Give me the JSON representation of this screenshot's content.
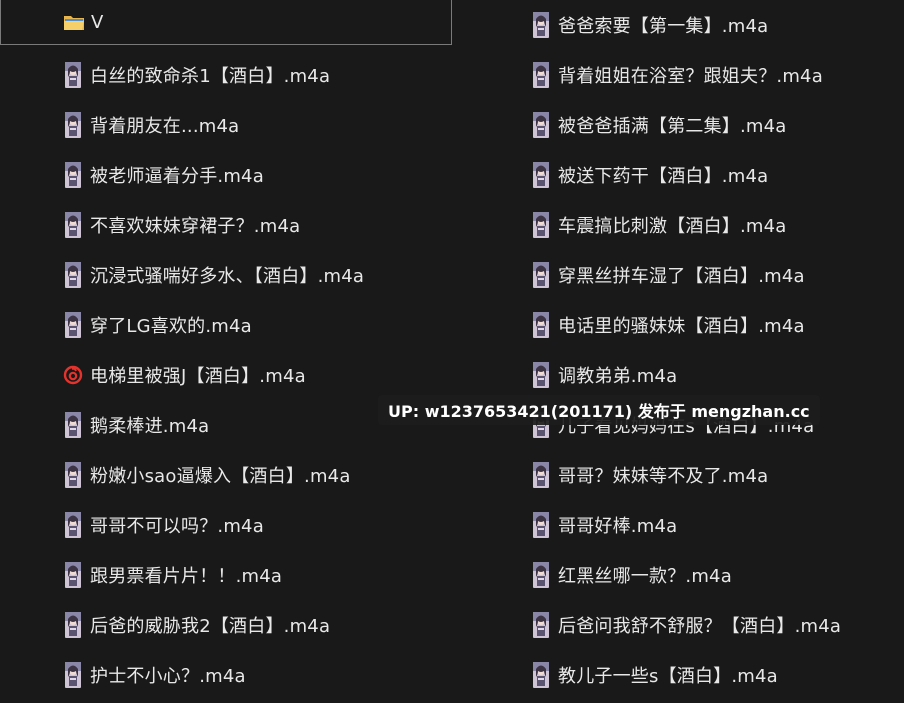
{
  "colors": {
    "background": "#191919",
    "text": "#e8e8e8",
    "selection_border": "#7a7a7a",
    "netease_icon": "#e4332c"
  },
  "folder": {
    "icon": "folder-icon",
    "label": "V"
  },
  "left_files": [
    {
      "icon": "audio-thumbnail-icon",
      "label": "白丝的致命杀1【酒白】.m4a"
    },
    {
      "icon": "audio-thumbnail-icon",
      "label": "背着朋友在...m4a"
    },
    {
      "icon": "audio-thumbnail-icon",
      "label": "被老师逼着分手.m4a"
    },
    {
      "icon": "audio-thumbnail-icon",
      "label": "不喜欢妹妹穿裙子？.m4a"
    },
    {
      "icon": "audio-thumbnail-icon",
      "label": "沉浸式骚喘好多水、【酒白】.m4a"
    },
    {
      "icon": "audio-thumbnail-icon",
      "label": "穿了LG喜欢的.m4a"
    },
    {
      "icon": "netease-music-icon",
      "label": "电梯里被强J【酒白】.m4a"
    },
    {
      "icon": "audio-thumbnail-icon",
      "label": "鹅柔棒进.m4a"
    },
    {
      "icon": "audio-thumbnail-icon",
      "label": "粉嫩小sao逼爆入【酒白】.m4a"
    },
    {
      "icon": "audio-thumbnail-icon",
      "label": "哥哥不可以吗？.m4a"
    },
    {
      "icon": "audio-thumbnail-icon",
      "label": "跟男票看片片！！.m4a"
    },
    {
      "icon": "audio-thumbnail-icon",
      "label": "后爸的威胁我2【酒白】.m4a"
    },
    {
      "icon": "audio-thumbnail-icon",
      "label": "护士不小心？.m4a"
    }
  ],
  "right_files": [
    {
      "icon": "audio-thumbnail-icon",
      "label": "爸爸索要【第一集】.m4a"
    },
    {
      "icon": "audio-thumbnail-icon",
      "label": "背着姐姐在浴室？跟姐夫？.m4a"
    },
    {
      "icon": "audio-thumbnail-icon",
      "label": "被爸爸插满【第二集】.m4a"
    },
    {
      "icon": "audio-thumbnail-icon",
      "label": "被送下药干【酒白】.m4a"
    },
    {
      "icon": "audio-thumbnail-icon",
      "label": "车震搞比刺激【酒白】.m4a"
    },
    {
      "icon": "audio-thumbnail-icon",
      "label": "穿黑丝拼车湿了【酒白】.m4a"
    },
    {
      "icon": "audio-thumbnail-icon",
      "label": "电话里的骚妹妹【酒白】.m4a"
    },
    {
      "icon": "audio-thumbnail-icon",
      "label": "调教弟弟.m4a"
    },
    {
      "icon": "audio-thumbnail-icon",
      "label": "儿子看见妈妈在s【酒白】.m4a"
    },
    {
      "icon": "audio-thumbnail-icon",
      "label": "哥哥？妹妹等不及了.m4a"
    },
    {
      "icon": "audio-thumbnail-icon",
      "label": "哥哥好棒.m4a"
    },
    {
      "icon": "audio-thumbnail-icon",
      "label": "红黑丝哪一款？.m4a"
    },
    {
      "icon": "audio-thumbnail-icon",
      "label": "后爸问我舒不舒服？【酒白】.m4a"
    },
    {
      "icon": "audio-thumbnail-icon",
      "label": "教儿子一些s【酒白】.m4a"
    }
  ],
  "watermark": {
    "text": "UP: w1237653421(201171) 发布于 mengzhan.cc"
  }
}
